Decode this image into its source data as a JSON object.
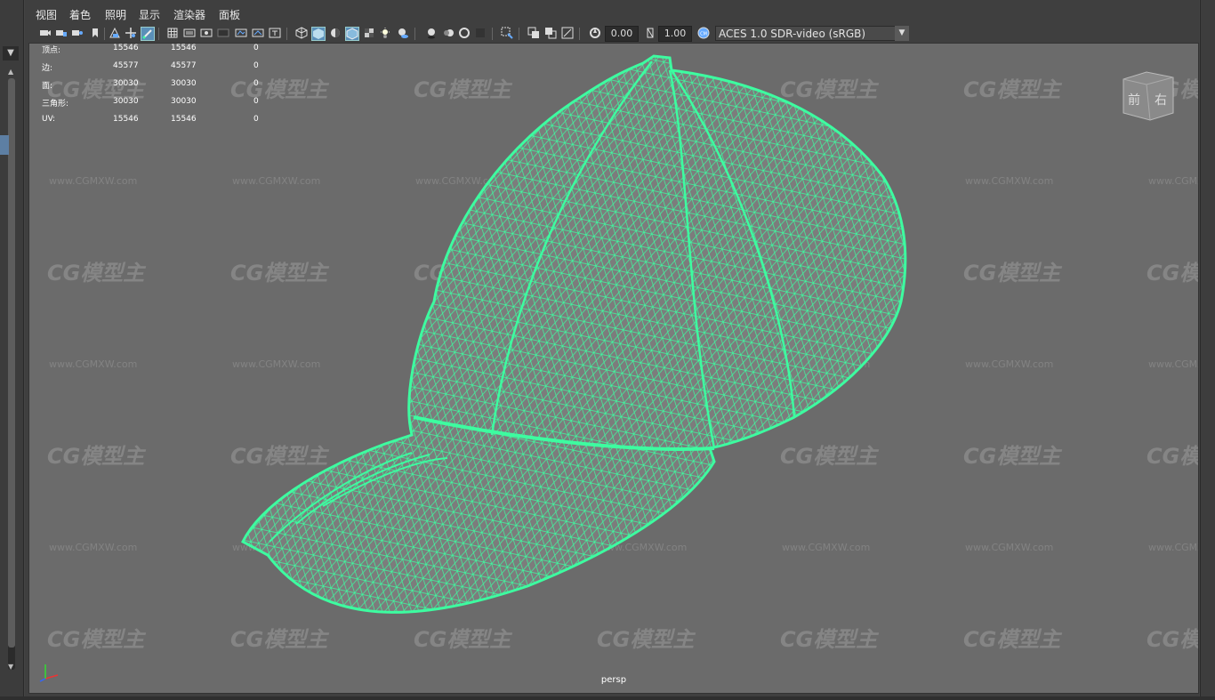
{
  "menu": [
    "视图",
    "着色",
    "照明",
    "显示",
    "渲染器",
    "面板"
  ],
  "toolbar": {
    "exposure_value": "0.00",
    "gamma_value": "1.00",
    "color_space": "ACES 1.0 SDR-video (sRGB)",
    "icons": [
      "camera-select-icon",
      "camera-lock-icon",
      "camera-attributes-icon",
      "bookmark-icon",
      "image-plane-icon",
      "2d-pan-zoom-icon",
      "grease-pencil-icon",
      "grid-icon",
      "film-gate-icon",
      "resolution-gate-icon",
      "gate-mask-icon",
      "field-chart-icon",
      "safe-action-icon",
      "safe-title-icon",
      "wireframe-icon",
      "smooth-shade-icon",
      "default-material-icon",
      "wireframe-on-shaded-icon",
      "textured-icon",
      "use-all-lights-icon",
      "shadows-icon",
      "screen-space-ao-icon",
      "motion-blur-icon",
      "multisample-aa-icon",
      "depth-of-field-icon",
      "isolate-select-icon",
      "xray-icon",
      "xray-joints-icon",
      "xray-components-icon",
      "exposure-icon",
      "gamma-icon",
      "color-management-icon"
    ]
  },
  "hud": {
    "rows": [
      {
        "label": "顶点:",
        "v1": "15546",
        "v2": "15546",
        "v3": "0"
      },
      {
        "label": "边:",
        "v1": "45577",
        "v2": "45577",
        "v3": "0"
      },
      {
        "label": "面:",
        "v1": "30030",
        "v2": "30030",
        "v3": "0"
      },
      {
        "label": "三角形:",
        "v1": "30030",
        "v2": "30030",
        "v3": "0"
      },
      {
        "label": "UV:",
        "v1": "15546",
        "v2": "15546",
        "v3": "0"
      }
    ]
  },
  "viewcube": {
    "front": "前",
    "right": "右"
  },
  "camera_label": "persp",
  "watermark": {
    "logo": "CG模型主",
    "url": "www.CGMXW.com"
  },
  "colors": {
    "wire": "#3dfca0",
    "viewport_bg": "#6b6b6b",
    "panel_bg": "#3f3f3f"
  }
}
